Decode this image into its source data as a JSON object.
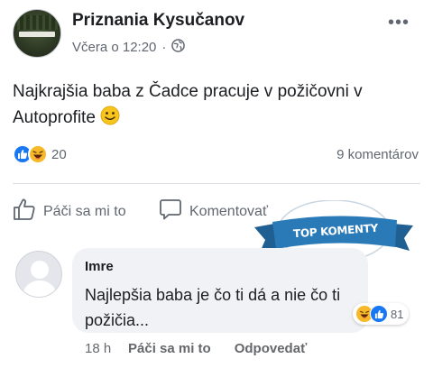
{
  "post": {
    "page_name": "Priznania Kysučanov",
    "timestamp": "Včera o 12:20",
    "separator": "·",
    "text": "Najkrajšia baba z Čadce pracuje v požičovni v Autoprofite",
    "reaction_count": "20",
    "comments_count": "9 komentárov"
  },
  "actions": {
    "like_label": "Páči sa mi to",
    "comment_label": "Komentovať"
  },
  "badge": {
    "label": "TOP KOMENTY",
    "color": "#2a7ab8"
  },
  "comment": {
    "author": "Imre",
    "text": "Najlepšia baba je čo ti dá a nie čo ti požičia...",
    "reaction_count": "81",
    "time": "18 h",
    "like_label": "Páči sa mi to",
    "reply_label": "Odpovedať"
  },
  "colors": {
    "like_blue": "#1877f2",
    "haha_yellow": "#f7b928",
    "secondary_text": "#606770"
  },
  "icons": [
    "globe-icon",
    "more-icon",
    "like-outline-icon",
    "comment-outline-icon",
    "like-reaction-icon",
    "haha-reaction-icon",
    "smile-emoji-icon",
    "default-avatar-icon"
  ]
}
